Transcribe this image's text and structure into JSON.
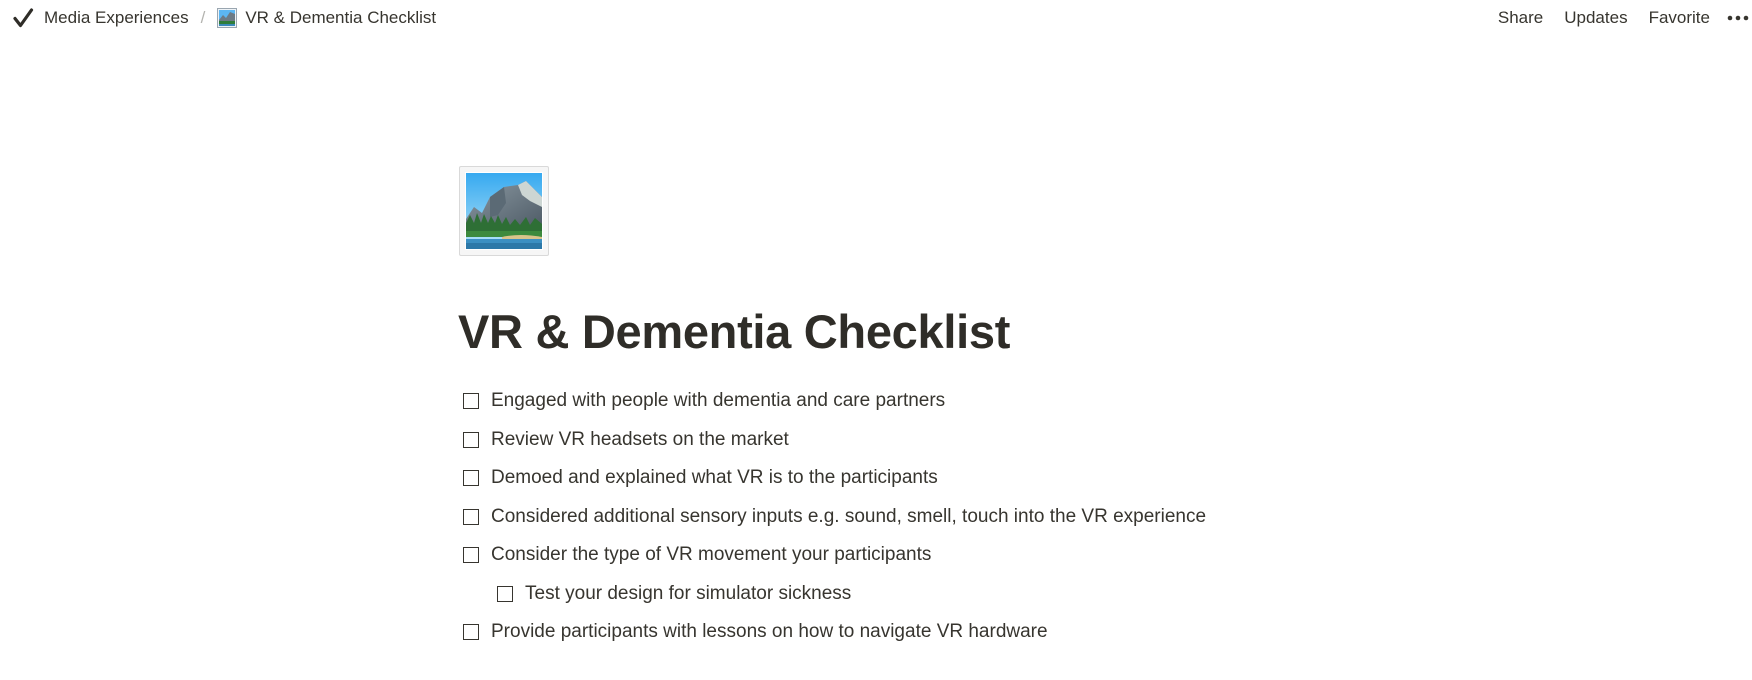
{
  "breadcrumb": {
    "workspace": "Media Experiences",
    "separator": "/",
    "page": "VR & Dementia Checklist"
  },
  "topbar_actions": {
    "share": "Share",
    "updates": "Updates",
    "favorite": "Favorite",
    "more_icon": "more-horizontal-icon"
  },
  "page": {
    "icon": "national-park-landscape-icon",
    "title": "VR & Dementia Checklist"
  },
  "todos": [
    {
      "text": "Engaged with people with dementia and care partners",
      "checked": false,
      "indent": 0
    },
    {
      "text": "Review VR headsets on the market",
      "checked": false,
      "indent": 0
    },
    {
      "text": "Demoed and explained what VR is to the participants",
      "checked": false,
      "indent": 0
    },
    {
      "text": "Considered additional sensory inputs e.g. sound, smell, touch into the VR experience",
      "checked": false,
      "indent": 0
    },
    {
      "text": "Consider the type of VR movement your participants",
      "checked": false,
      "indent": 0
    },
    {
      "text": "Test your design for simulator sickness",
      "checked": false,
      "indent": 1
    },
    {
      "text": "Provide participants with lessons on how to navigate VR hardware",
      "checked": false,
      "indent": 0
    }
  ],
  "colors": {
    "text": "#37352f",
    "title": "#2f2d28",
    "separator": "#b4b4b0",
    "background": "#ffffff"
  }
}
